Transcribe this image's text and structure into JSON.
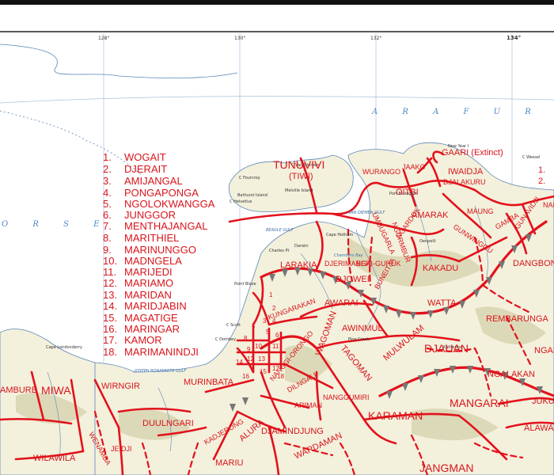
{
  "sea_text": "A R A F U R A",
  "sea_text_left": "O R S E",
  "longitudes": [
    "128°",
    "130°",
    "132°",
    "134°"
  ],
  "legend": [
    {
      "num": "1.",
      "name": "WOGAIT"
    },
    {
      "num": "2.",
      "name": "DJERAIT"
    },
    {
      "num": "3.",
      "name": "AMIJANGAL"
    },
    {
      "num": "4.",
      "name": "PONGAPONGA"
    },
    {
      "num": "5.",
      "name": "NGOLOKWANGGA"
    },
    {
      "num": "6.",
      "name": "JUNGGOR"
    },
    {
      "num": "7.",
      "name": "MENTHAJANGAL"
    },
    {
      "num": "8.",
      "name": "MARITHIEL"
    },
    {
      "num": "9.",
      "name": "MARINUNGGO"
    },
    {
      "num": "10.",
      "name": "MADNGELA"
    },
    {
      "num": "11.",
      "name": "MARIJEDI"
    },
    {
      "num": "12.",
      "name": "MARIAMO"
    },
    {
      "num": "13.",
      "name": "MARIDAN"
    },
    {
      "num": "14.",
      "name": "MARIDJABIN"
    },
    {
      "num": "15.",
      "name": "MAGATIGE"
    },
    {
      "num": "16.",
      "name": "MARINGAR"
    },
    {
      "num": "17.",
      "name": "KAMOR"
    },
    {
      "num": "18.",
      "name": "MARIMANINDJI"
    }
  ],
  "legend_right": [
    "1.",
    "2."
  ],
  "tribes": {
    "tunuvivi": "TUNUVIVI",
    "tiwi": "(TIWI)",
    "wurango": "WURANGO",
    "jaako": "JAAKO",
    "iwaidja": "IWAIDJA",
    "gaari": "GAARI (Extinct)",
    "oitbi": "OITBI",
    "djalakuru": "DJALAKURU",
    "amarak": "AMARAK",
    "maung": "MAUNG",
    "gunwinggu": "GUNWINGGU",
    "gamba": "GAMBA",
    "gunavidji": "GUNAVIDJI",
    "nakar": "NAKA",
    "ngardok": "NGARDOK",
    "ngormbur": "NGORMBUR",
    "kakadu": "KAKADU",
    "umbugarla": "UMBUGARLA",
    "djerimanga": "DJERIMANGA",
    "beriguruk": "BERI-GURUK",
    "larakia": "LARAKIA",
    "djowei": "DJOWEI",
    "bunitj": "BUNEITJA",
    "awarai": "AWARAI",
    "kungarakan": "KUNGARAKAN",
    "awinmul": "AWINMUL",
    "watta": "WATTA",
    "dangbon": "DANGBON",
    "rembarunga": "REMBARUNGA",
    "mulwulam": "MULWULAM",
    "djauan": "DJAUAN",
    "ngandi": "NGAND",
    "ngalakan": "NGALAKAN",
    "tagoman": "TAGOMAN",
    "wagoman": "WAGOMAN",
    "nanggiorongo": "NANGGI-ORONGO",
    "dilngali": "DILNGALI",
    "ariman": "ARIMAN",
    "nanggumiri": "NANGGUMIRI",
    "karaman": "KARAMAN",
    "mangarai": "MANGARAI",
    "jukul": "JUKUL",
    "alawa": "ALAWA",
    "murinbata": "MURINBATA",
    "kadjerong": "KADJERONG",
    "alura": "ALURA",
    "djamindjung": "DJAMINDJUNG",
    "wardaman": "WARDAMAN",
    "jangman": "JANGMAN",
    "mariu": "MARIU",
    "wirngir": "WIRNGIR",
    "miwa": "MIWA",
    "gambure": "AMBURE",
    "wilawila": "WILAWILA",
    "duulngari": "DUULNGARI",
    "jeidji": "JEIDJI",
    "wenamba": "WENAMBA",
    "kungarakan_small": "KUNGARAKAN"
  },
  "places": {
    "bathurst": "Bathurst Island",
    "melville": "Melville Island",
    "cape_fourcroy": "C Fourcroy",
    "cape_helvetius": "C Helvetius",
    "beagle_gulf": "BEAGLE GULF",
    "darwin": "Darwin",
    "charles_pt": "Charles Pt",
    "cape_van_diemen": "C Van Diemen",
    "cape_hotham": "Cape Hotham",
    "chambers_bay": "Chambers Bay",
    "van_diemen_gulf": "VAN DIEMEN GULF",
    "cape_scott": "C Scott",
    "cape_dombey": "C Dombey",
    "cape_londonderry": "Cape Londonderry",
    "bonaparte_gulf": "JOSEPH BONAPARTE GULF",
    "new_year_i": "New Year I",
    "port_essington": "Port Essington",
    "point_blaze": "Point Blaze",
    "oenpelli": "Oenpelli",
    "pine_creek": "Pine Creek",
    "katherine": "Katherine",
    "cape_wessel": "C Wessel"
  },
  "colors": {
    "boundary": "#e3111b",
    "label": "#d9141c",
    "water": "#4a86c5",
    "land": "#f3f0dc",
    "relief": "#c9c79a"
  }
}
